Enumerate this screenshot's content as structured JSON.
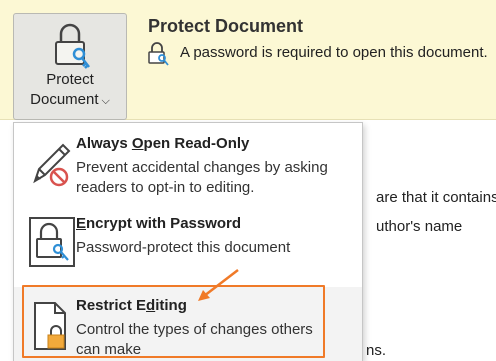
{
  "banner": {
    "button_line1": "Protect",
    "button_line2": "Document",
    "title": "Protect Document",
    "description": "A password is required to open this document."
  },
  "background": {
    "line1": "are that it contains:",
    "line2": "uthor's name",
    "line3": "ns."
  },
  "menu": {
    "items": [
      {
        "title": "Always Open Read-Only",
        "mnemonic": "O",
        "desc_line1": "Prevent accidental changes by asking",
        "desc_line2": "readers to opt-in to editing.",
        "icon": "pencil-prohibited-icon"
      },
      {
        "title": "Encrypt with Password",
        "mnemonic": "E",
        "desc_line1": "Password-protect this document",
        "icon": "lock-key-icon"
      },
      {
        "title": "Restrict Editing",
        "mnemonic": "d",
        "desc_line1": "Control the types of changes others",
        "desc_line2": "can make",
        "icon": "document-lock-icon"
      }
    ]
  },
  "colors": {
    "banner": "#fcf8d4",
    "highlight": "#f07a28",
    "key": "#2f8fd6",
    "lock_gold": "#f2a93b"
  }
}
